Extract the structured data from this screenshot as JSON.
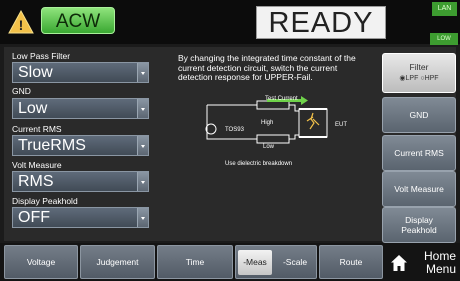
{
  "header": {
    "mode": "ACW",
    "status": "READY",
    "lan": "LAN",
    "low_indicator": "LOW"
  },
  "settings": [
    {
      "label": "Low Pass Filter",
      "value": "Slow"
    },
    {
      "label": "GND",
      "value": "Low"
    },
    {
      "label": "Current RMS",
      "value": "TrueRMS"
    },
    {
      "label": "Volt Measure",
      "value": "RMS"
    },
    {
      "label": "Display Peakhold",
      "value": "OFF"
    }
  ],
  "description": "By changing the integrated time constant of the current detection circuit, switch the current detection response for UPPER-Fail.",
  "diagram": {
    "test_current": "Test Current",
    "high": "High",
    "device": "TOS93",
    "low": "Low",
    "eut": "EUT",
    "caption": "Use dielectric breakdown"
  },
  "right_buttons": {
    "filter": {
      "title": "Filter",
      "opt1": "LPF",
      "opt2": "HPF",
      "selected": "LPF"
    },
    "gnd": "GND",
    "current_rms": "Current RMS",
    "volt_measure": "Volt Measure",
    "display_peakhold_l1": "Display",
    "display_peakhold_l2": "Peakhold"
  },
  "tabs": {
    "voltage": "Voltage",
    "judgement": "Judgement",
    "time": "Time",
    "meas": "-Meas",
    "scale": "-Scale",
    "route": "Route"
  },
  "home": {
    "l1": "Home",
    "l2": "Menu"
  },
  "colors": {
    "mode_green": "#4cbf3c",
    "panel": "#2a2a2a",
    "button": "#6a7480"
  },
  "icons": {
    "warning": "warning-triangle-icon",
    "home": "home-icon",
    "dropdown": "chevron-down-icon"
  }
}
